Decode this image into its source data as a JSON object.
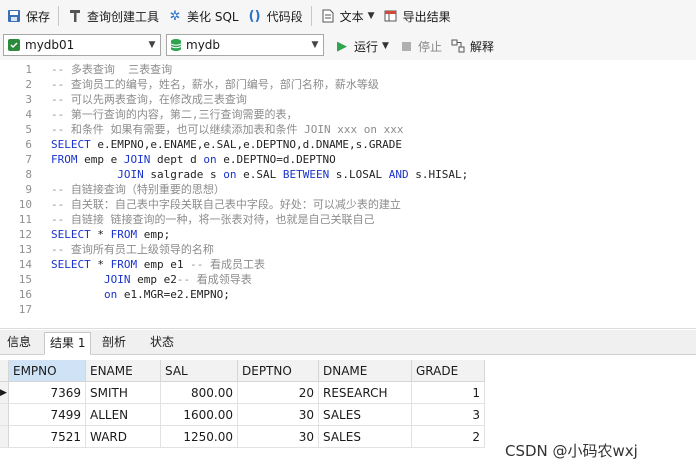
{
  "toolbar": {
    "save": "保存",
    "query_builder": "查询创建工具",
    "beautify": "美化 SQL",
    "snippet": "代码段",
    "text": "文本",
    "export": "导出结果"
  },
  "connection": {
    "connection": "mydb01",
    "database": "mydb",
    "run": "运行",
    "stop": "停止",
    "explain": "解释"
  },
  "editor": {
    "line_numbers": [
      "1",
      "2",
      "3",
      "4",
      "5",
      "6",
      "7",
      "8",
      "9",
      "10",
      "11",
      "12",
      "13",
      "14",
      "15",
      "16",
      "17"
    ],
    "lines": [
      [
        {
          "t": "cm",
          "v": "-- 多表查询  三表查询"
        }
      ],
      [
        {
          "t": "cm",
          "v": "-- 查询员工的编号，姓名，薪水，部门编号，部门名称，薪水等级"
        }
      ],
      [
        {
          "t": "cm",
          "v": "-- 可以先两表查询，在修改成三表查询"
        }
      ],
      [
        {
          "t": "cm",
          "v": "-- 第一行查询的内容，第二,三行查询需要的表，"
        }
      ],
      [
        {
          "t": "cm",
          "v": "-- 和条件 如果有需要，也可以继续添加表和条件 JOIN xxx on xxx"
        }
      ],
      [
        {
          "t": "kw",
          "v": "SELECT"
        },
        {
          "t": "tx",
          "v": " e.EMPNO,e.ENAME,e.SAL,e.DEPTNO,d.DNAME,s.GRADE"
        }
      ],
      [
        {
          "t": "kw",
          "v": "FROM"
        },
        {
          "t": "tx",
          "v": " emp e "
        },
        {
          "t": "kw",
          "v": "JOIN"
        },
        {
          "t": "tx",
          "v": " dept d "
        },
        {
          "t": "kw",
          "v": "on"
        },
        {
          "t": "tx",
          "v": " e.DEPTNO=d.DEPTNO"
        }
      ],
      [
        {
          "t": "tx",
          "v": "          "
        },
        {
          "t": "kw",
          "v": "JOIN"
        },
        {
          "t": "tx",
          "v": " salgrade s "
        },
        {
          "t": "kw",
          "v": "on"
        },
        {
          "t": "tx",
          "v": " e.SAL "
        },
        {
          "t": "kw",
          "v": "BETWEEN"
        },
        {
          "t": "tx",
          "v": " s.LOSAL "
        },
        {
          "t": "kw",
          "v": "AND"
        },
        {
          "t": "tx",
          "v": " s.HISAL;"
        }
      ],
      [
        {
          "t": "cm",
          "v": "-- 自链接查询（特别重要的思想）"
        }
      ],
      [
        {
          "t": "cm",
          "v": "-- 自关联：自己表中字段关联自己表中字段。好处：可以减少表的建立"
        }
      ],
      [
        {
          "t": "cm",
          "v": "-- 自链接 链接查询的一种，将一张表对待，也就是自己关联自己"
        }
      ],
      [
        {
          "t": "kw",
          "v": "SELECT"
        },
        {
          "t": "tx",
          "v": " * "
        },
        {
          "t": "kw",
          "v": "FROM"
        },
        {
          "t": "tx",
          "v": " emp;"
        }
      ],
      [
        {
          "t": "cm",
          "v": "-- 查询所有员工上级领导的名称"
        }
      ],
      [
        {
          "t": "kw",
          "v": "SELECT"
        },
        {
          "t": "tx",
          "v": " * "
        },
        {
          "t": "kw",
          "v": "FROM"
        },
        {
          "t": "tx",
          "v": " emp e1 "
        },
        {
          "t": "cm",
          "v": "-- 看成员工表"
        }
      ],
      [
        {
          "t": "tx",
          "v": "        "
        },
        {
          "t": "kw",
          "v": "JOIN"
        },
        {
          "t": "tx",
          "v": " emp e2"
        },
        {
          "t": "cm",
          "v": "-- 看成领导表"
        }
      ],
      [
        {
          "t": "tx",
          "v": "        "
        },
        {
          "t": "kw",
          "v": "on"
        },
        {
          "t": "tx",
          "v": " e1.MGR=e2.EMPNO;"
        }
      ],
      []
    ]
  },
  "result_tabs": [
    "信息",
    "结果 1",
    "剖析",
    "状态"
  ],
  "results": {
    "columns": [
      "EMPNO",
      "ENAME",
      "SAL",
      "DEPTNO",
      "DNAME",
      "GRADE"
    ],
    "rows": [
      [
        "7369",
        "SMITH",
        "800.00",
        "20",
        "RESEARCH",
        "1"
      ],
      [
        "7499",
        "ALLEN",
        "1600.00",
        "30",
        "SALES",
        "3"
      ],
      [
        "7521",
        "WARD",
        "1250.00",
        "30",
        "SALES",
        "2"
      ]
    ]
  },
  "watermark": "CSDN @小码农wxj",
  "colors": {
    "keyword": "#1a33cc",
    "comment": "#8c8c8c",
    "run_green": "#2ea44f"
  }
}
